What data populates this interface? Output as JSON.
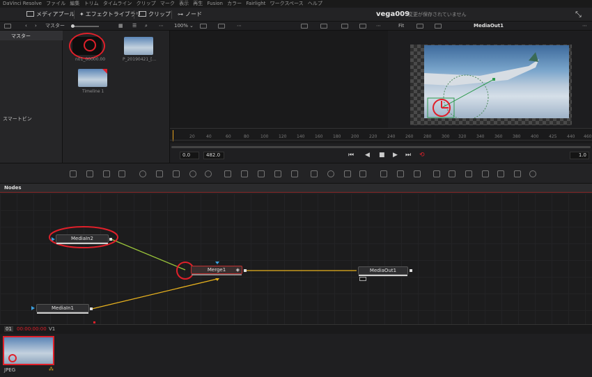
{
  "menubar": {
    "items": [
      "DaVinci Resolve",
      "ファイル",
      "編集",
      "トリム",
      "タイムライン",
      "クリップ",
      "マーク",
      "表示",
      "再生",
      "Fusion",
      "カラー",
      "Fairlight",
      "ワークスペース",
      "ヘルプ"
    ]
  },
  "toolbar": {
    "media_pool_label": "メディアプール",
    "effects_library_label": "エフェクトライブラリ",
    "clips_label": "クリップ",
    "nodes_label": "ノード",
    "project_title": "vega009",
    "save_status": "変更が保存されていません"
  },
  "subbar": {
    "master_label": "マスター",
    "zoom_label": "100%",
    "fit_label": "Fit",
    "viewer_title": "MediaOut1"
  },
  "sidebar": {
    "master_label": "マスター",
    "smart_bins_label": "スマートビン"
  },
  "media_pool": {
    "items": [
      {
        "label": "n01_00000.00"
      },
      {
        "label": "P_20190421_[..."
      },
      {
        "label": "Timeline 1"
      }
    ]
  },
  "ruler": {
    "ticks": [
      "20",
      "40",
      "60",
      "80",
      "100",
      "120",
      "140",
      "160",
      "180",
      "200",
      "220",
      "240",
      "260",
      "280",
      "300",
      "320",
      "340",
      "360",
      "380",
      "400",
      "425",
      "440",
      "460"
    ]
  },
  "playback": {
    "start_value": "0.0",
    "end_value": "482.0",
    "speed_value": "1.0"
  },
  "nodes": {
    "panel_title": "Nodes",
    "media_in_2": "MediaIn2",
    "merge_1": "Merge1",
    "media_out_1": "MediaOut1",
    "media_in_1": "MediaIn1"
  },
  "clip_strip": {
    "track_number": "01",
    "timecode": "00:00:00:00",
    "track_label": "V1",
    "clip_format": "JPEG"
  },
  "colors": {
    "accent_red": "#e0202a",
    "link_yellow": "#e8b21e",
    "link_green": "#9ac43a",
    "node_ul": "#cfcfcf"
  }
}
